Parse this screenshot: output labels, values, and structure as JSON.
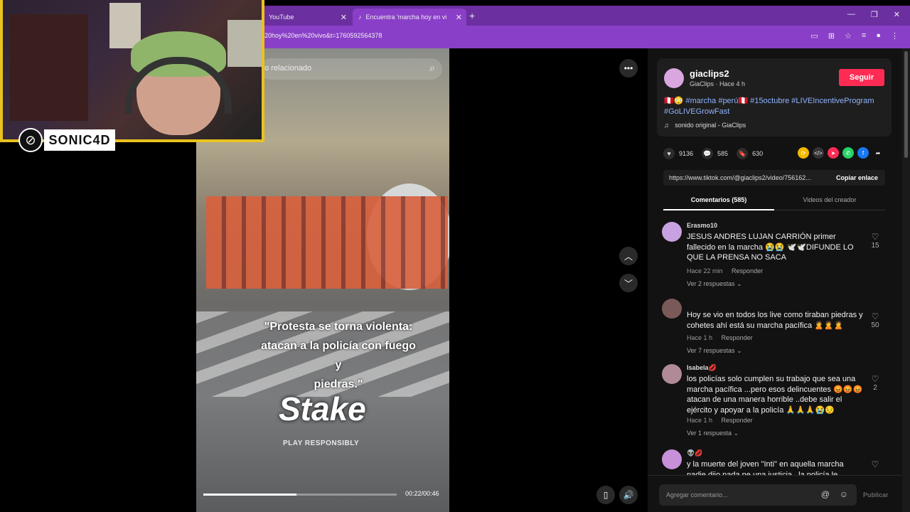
{
  "browser": {
    "tabs": [
      {
        "label": "YouTube",
        "favicon": "youtube-icon"
      },
      {
        "label": "Encuentra 'marcha hoy en vi",
        "favicon": "tiktok-icon"
      }
    ],
    "url": "20hoy%20en%20vivo&t=1760592564378"
  },
  "stream": {
    "overlay_name": "SONIC4D"
  },
  "video": {
    "search_placeholder": "do relacionado",
    "caption_lines": [
      "\"Protesta se torna violenta:",
      "atacan a la policía con fuego y",
      "piedras.\""
    ],
    "brand": "Stake",
    "brand_sub": "PLAY RESPONSIBLY",
    "progress": 0.48,
    "time": "00:22/00:46"
  },
  "post": {
    "username": "giaclips2",
    "subline": "GiaClips · Hace 4 h",
    "follow_label": "Seguir",
    "description_prefix": "🇵🇪😳",
    "hashtags": "#marcha #perú🇵🇪 #15octubre #LIVEIncentiveProgram #GoLIVEGrowFast",
    "music": "sonido original - GiaClips",
    "likes": "9136",
    "comments_count": "585",
    "saves": "630",
    "link": "https://www.tiktok.com/@giaclips2/video/756162...",
    "copy_label": "Copiar enlace",
    "tab_comments": "Comentarios (585)",
    "tab_creator": "Videos del creador"
  },
  "comments": [
    {
      "user": "Erasmo10",
      "text": "JESUS ANDRES LUJAN CARRIÓN primer fallecido en la marcha 😭😭 🕊️🕊️DIFUNDE LO QUE LA PRENSA NO SACA",
      "time": "Hace 22 min",
      "reply": "Responder",
      "more": "Ver 2 respuestas",
      "likes": "15",
      "avatar_color": "#c8a2e0"
    },
    {
      "user": "",
      "text": "Hoy se vio en todos los live como tiraban piedras y cohetes ahí está su marcha pacífica 🙎🙎🙎",
      "time": "Hace 1 h",
      "reply": "Responder",
      "more": "Ver 7 respuestas",
      "likes": "50",
      "avatar_color": "#7a5a58"
    },
    {
      "user": "Isabela💋",
      "text": "los policías solo cumplen su trabajo que sea una marcha pacífica ...pero esos delincuentes 😡😡😡 atacan de una manera horrible ..debe salir el ejército y apoyar a la policía 🙏🙏🙏😭😔",
      "time": "Hace 1 h",
      "reply": "Responder",
      "more": "Ver 1 respuesta",
      "likes": "2",
      "avatar_color": "#b08a98"
    },
    {
      "user": "👽💋",
      "text": "y la muerte del joven \"Inti\" en aquella marcha nadie dijo nada ne una justicia...la policía le disparó... ???",
      "time": "",
      "reply": "",
      "more": "",
      "likes": "",
      "avatar_color": "#c890d8"
    }
  ],
  "composer": {
    "placeholder": "Agregar comentario...",
    "publish": "Publicar"
  }
}
